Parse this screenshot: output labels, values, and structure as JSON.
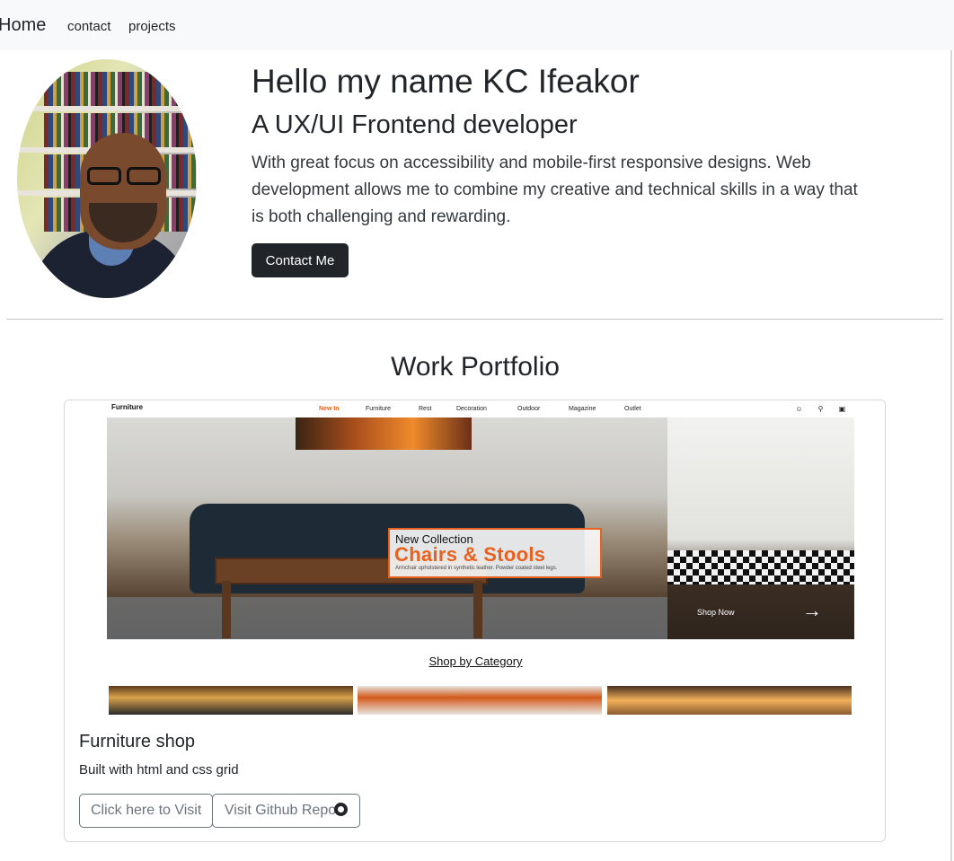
{
  "nav": {
    "brand": "Home",
    "links": [
      "contact",
      "projects"
    ]
  },
  "hero": {
    "title": "Hello my name KC Ifeakor",
    "subtitle": "A UX/UI Frontend developer",
    "description": "With great focus on accessibility and mobile-first responsive designs. Web development allows me to combine my creative and technical skills in a way that is both challenging and rewarding.",
    "contact_button": "Contact Me"
  },
  "portfolio": {
    "heading": "Work Portfolio",
    "projects": [
      {
        "title": "Furniture shop",
        "description": "Built with html and css grid",
        "visit_button": "Click here to Visit",
        "github_button": "Visit Github Repo",
        "screenshot": {
          "brand": "Furniture",
          "nav": [
            "New In",
            "Furniture",
            "Rest",
            "Decoration",
            "Outdoor",
            "Magazine",
            "Outlet"
          ],
          "promo_small": "New Collection",
          "promo_big": "Chairs & Stools",
          "promo_tiny": "Armchair upholstered in synthetic leather. Powder coated steel legs.",
          "shop_now": "Shop Now",
          "category_link": "Shop by Category"
        }
      }
    ]
  },
  "colors": {
    "navbar_bg": "#f8f9fa",
    "dark_button": "#212529",
    "accent_orange": "#e8611e",
    "outline_gray": "#6c757d"
  }
}
